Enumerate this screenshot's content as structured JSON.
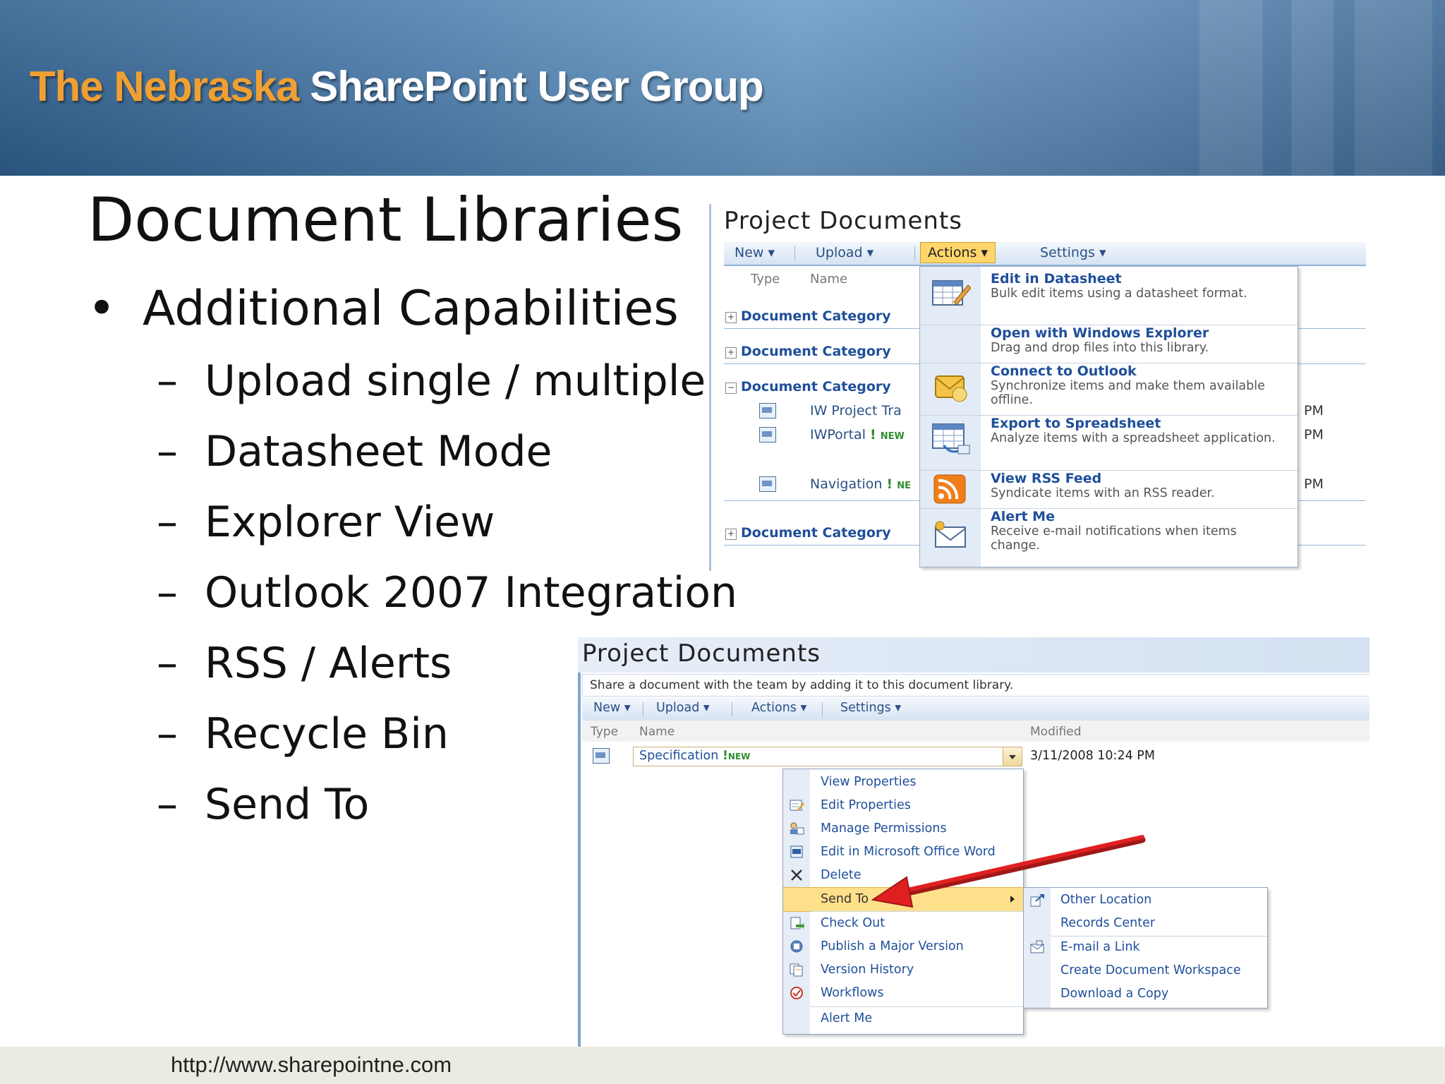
{
  "banner": {
    "title_part1": "The Nebraska",
    "title_part2": "SharePoint User Group"
  },
  "slide": {
    "title": "Document Libraries",
    "bullet_symbol": "•",
    "bullet": "Additional Capabilities",
    "dash": "–",
    "subitems": [
      "Upload single / multiple",
      "Datasheet Mode",
      "Explorer View",
      "Outlook 2007 Integration",
      "RSS / Alerts",
      "Recycle Bin",
      "Send To"
    ]
  },
  "footer": {
    "url": "http://www.sharepointne.com"
  },
  "shot1": {
    "title": "Project Documents",
    "toolbar": {
      "new": "New",
      "upload": "Upload",
      "actions": "Actions",
      "settings": "Settings"
    },
    "columns": {
      "type": "Type",
      "name": "Name"
    },
    "category_label": "Document Category",
    "docs": [
      "IW Project Tra",
      "IWPortal",
      "Navigation"
    ],
    "new_badge": "NEW",
    "new_badge_cut": "NE",
    "excl": "!",
    "time_suffix": "PM",
    "actions_menu": [
      {
        "title": "Edit in Datasheet",
        "desc": "Bulk edit items using a datasheet format.",
        "icon": "datasheet-icon"
      },
      {
        "title": "Open with Windows Explorer",
        "desc": "Drag and drop files into this library.",
        "icon": "explorer-icon"
      },
      {
        "title": "Connect to Outlook",
        "desc": "Synchronize items and make them available offline.",
        "icon": "outlook-icon"
      },
      {
        "title": "Export to Spreadsheet",
        "desc": "Analyze items with a spreadsheet application.",
        "icon": "spreadsheet-icon"
      },
      {
        "title": "View RSS Feed",
        "desc": "Syndicate items with an RSS reader.",
        "icon": "rss-icon"
      },
      {
        "title": "Alert Me",
        "desc": "Receive e-mail notifications when items change.",
        "icon": "alert-icon"
      }
    ]
  },
  "shot2": {
    "title": "Project Documents",
    "description": "Share a document with the team by adding it to this document library.",
    "toolbar": {
      "new": "New",
      "upload": "Upload",
      "actions": "Actions",
      "settings": "Settings"
    },
    "columns": {
      "type": "Type",
      "name": "Name",
      "modified": "Modified"
    },
    "doc_name": "Specification",
    "excl": "!",
    "new_badge": "NEW",
    "modified": "3/11/2008 10:24 PM",
    "context_menu": [
      "View Properties",
      "Edit Properties",
      "Manage Permissions",
      "Edit in Microsoft Office Word",
      "Delete",
      "Send To",
      "Check Out",
      "Publish a Major Version",
      "Version History",
      "Workflows",
      "Alert Me"
    ],
    "send_to_menu": [
      "Other Location",
      "Records Center",
      "E-mail a Link",
      "Create Document Workspace",
      "Download a Copy"
    ]
  },
  "colors": {
    "banner_orange": "#f0a032",
    "link_blue": "#1f4f9a",
    "highlight": "#ffe08a",
    "arrow_red": "#e02020"
  }
}
